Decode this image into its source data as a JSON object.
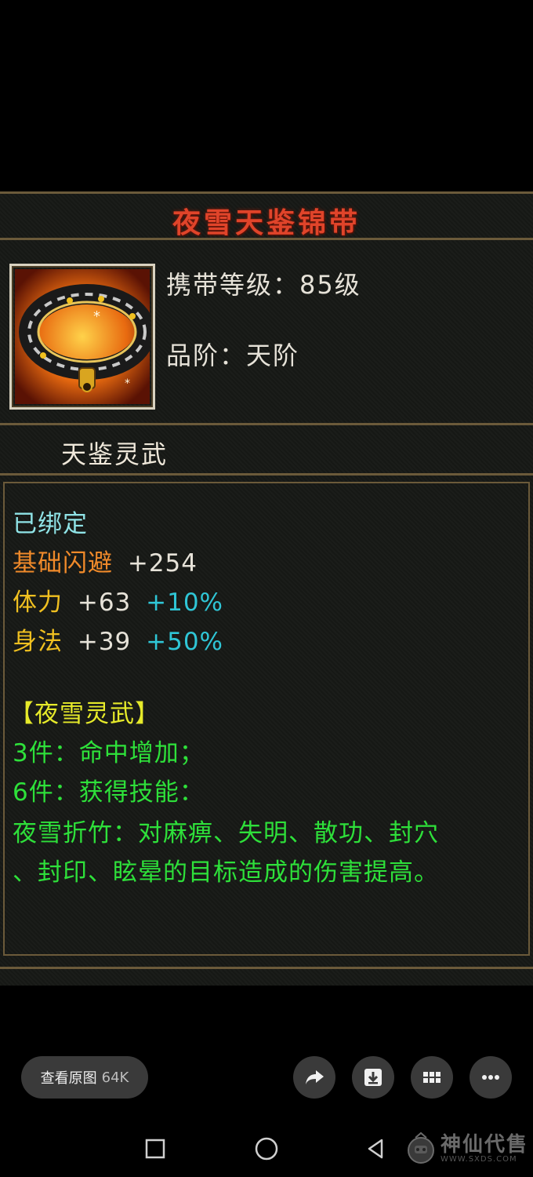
{
  "item": {
    "name": "夜雪天鉴锦带",
    "carry_level": "携带等级：85级",
    "grade": "品阶：天阶",
    "set_name": "天鉴灵武"
  },
  "attributes": {
    "bound": "已绑定",
    "dodge_label": "基础闪避",
    "dodge_value": "+254",
    "stamina_label": "体力",
    "stamina_value": "+63",
    "stamina_pct": "+10%",
    "agility_label": "身法",
    "agility_value": "+39",
    "agility_pct": "+50%"
  },
  "set_bonus": {
    "title": "【夜雪灵武】",
    "three_piece": "3件：命中增加；",
    "six_piece": "6件：获得技能：",
    "skill_line1": "夜雪折竹：对麻痹、失明、散功、封穴",
    "skill_line2": "、封印、眩晕的目标造成的伤害提高。"
  },
  "viewer": {
    "view_original_label": "查看原图",
    "size_label": "64K"
  },
  "watermark": {
    "text": "神仙代售",
    "url": "WWW.SXDS.COM"
  }
}
